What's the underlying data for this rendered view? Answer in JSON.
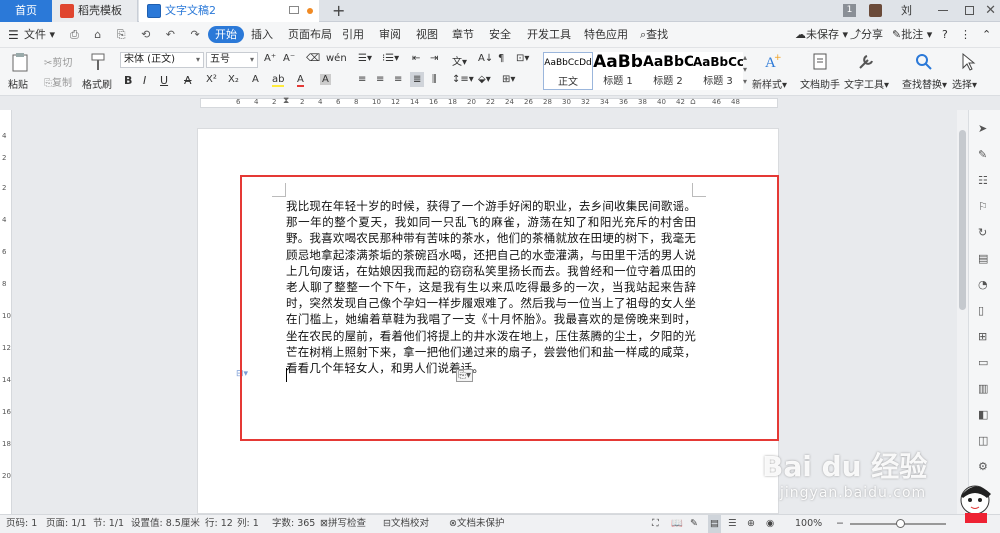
{
  "tabs": {
    "home": "首页",
    "shell_template": "稻壳模板",
    "document": "文字文稿2",
    "page_count": "1",
    "user": "刘真"
  },
  "menu": {
    "file": "文件",
    "items": [
      "开始",
      "插入",
      "页面布局",
      "引用",
      "审阅",
      "视图",
      "章节",
      "安全",
      "开发工具",
      "特色应用"
    ],
    "search": "查找",
    "unsaved": "未保存",
    "share": "分享",
    "annotate": "批注"
  },
  "ribbon": {
    "paste": "粘贴",
    "cut": "剪切",
    "copy": "复制",
    "format_painter": "格式刷",
    "font_name": "宋体 (正文)",
    "font_size": "五号",
    "styles": [
      {
        "preview": "AaBbCcDd",
        "name": "正文"
      },
      {
        "preview": "AaBb",
        "name": "标题 1"
      },
      {
        "preview": "AaBbC",
        "name": "标题 2"
      },
      {
        "preview": "AaBbCc",
        "name": "标题 3"
      }
    ],
    "new_style": "新样式",
    "doc_assistant": "文档助手",
    "text_tools": "文字工具",
    "find_replace": "查找替换",
    "select": "选择"
  },
  "ruler": {
    "h_numbers": [
      "6",
      "4",
      "2",
      "2",
      "4",
      "6",
      "8",
      "10",
      "12",
      "14",
      "16",
      "18",
      "20",
      "22",
      "24",
      "26",
      "28",
      "30",
      "32",
      "34",
      "36",
      "38",
      "40",
      "42",
      "46",
      "48"
    ],
    "v_numbers": [
      "4",
      "2",
      "2",
      "4",
      "6",
      "8",
      "10",
      "12",
      "14",
      "16",
      "18",
      "20"
    ]
  },
  "document": {
    "body": "我比现在年轻十岁的时候，获得了一个游手好闲的职业，去乡间收集民间歌谣。那一年的整个夏天，我如同一只乱飞的麻雀，游荡在知了和阳光充斥的村舍田野。我喜欢喝农民那种带有苦味的茶水，他们的茶桶就放在田埂的树下，我毫无顾忌地拿起漆满茶垢的茶碗舀水喝，还把自己的水壶灌满，与田里干活的男人说上几句废话，在姑娘因我而起的窃窃私笑里扬长而去。我曾经和一位守着瓜田的老人聊了整整一个下午，这是我有生以来瓜吃得最多的一次，当我站起来告辞时，突然发现自己像个孕妇一样步履艰难了。然后我与一位当上了祖母的女人坐在门槛上，她编着草鞋为我唱了一支《十月怀胎》。我最喜欢的是傍晚来到时，坐在农民的屋前，看着他们将提上的井水泼在地上，压住蒸腾的尘土，夕阳的光芒在树梢上照射下来，拿一把他们递过来的扇子，尝尝他们和盐一样咸的咸菜，看看几个年轻女人，和男人们说着话。"
  },
  "status": {
    "page_no": "页码: 1",
    "pages": "页面: 1/1",
    "section": "节: 1/1",
    "setting": "设置值: 8.5厘米",
    "row": "行: 12",
    "col": "列: 1",
    "word_count": "字数: 365",
    "spell_check": "拼写检查",
    "doc_proof": "文档校对",
    "doc_protect": "文档未保护",
    "zoom": "100%"
  },
  "watermark": {
    "logo": "Bai du 经验",
    "url": "jingyan.baidu.com"
  },
  "colors": {
    "accent": "#2b79d8",
    "highlight_box": "#e53935"
  }
}
